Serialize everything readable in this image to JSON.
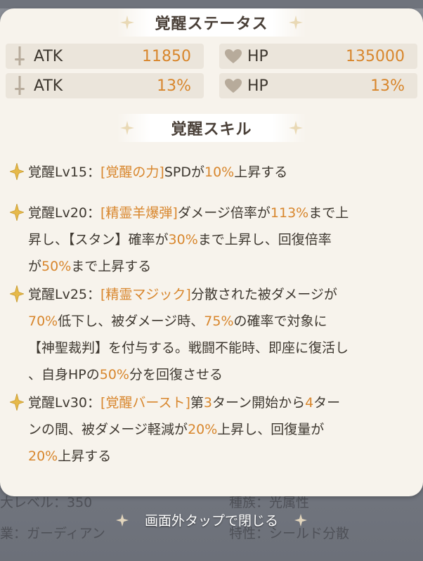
{
  "panel": {
    "status_title": "覚醒ステータス",
    "skill_title": "覚醒スキル"
  },
  "stats": [
    {
      "name": "ATK",
      "value": "11850",
      "icon": "sword-icon"
    },
    {
      "name": "HP",
      "value": "135000",
      "icon": "heart-icon"
    },
    {
      "name": "ATK",
      "value": "13%",
      "icon": "sword-icon"
    },
    {
      "name": "HP",
      "value": "13%",
      "icon": "heart-icon"
    }
  ],
  "skills": [
    {
      "lines": [
        [
          [
            "覚醒Lv15：",
            ""
          ],
          [
            "[覚醒の力]",
            "hl"
          ],
          [
            "SPDが",
            ""
          ],
          [
            "10%",
            "hl"
          ],
          [
            "上昇する",
            ""
          ]
        ]
      ]
    },
    {
      "lines": [
        [
          [
            "覚醒Lv20：",
            ""
          ],
          [
            "[精霊羊爆弾]",
            "hl"
          ],
          [
            "ダメージ倍率が",
            ""
          ],
          [
            "113%",
            "hl"
          ],
          [
            "まで上",
            ""
          ]
        ],
        [
          [
            "昇し、【スタン】確率が",
            ""
          ],
          [
            "30%",
            "hl"
          ],
          [
            "まで上昇し、回復倍率",
            ""
          ]
        ],
        [
          [
            "が",
            ""
          ],
          [
            "50%",
            "hl"
          ],
          [
            "まで上昇する",
            ""
          ]
        ]
      ]
    },
    {
      "lines": [
        [
          [
            "覚醒Lv25：",
            ""
          ],
          [
            "[精霊マジック]",
            "hl"
          ],
          [
            "分散された被ダメージが",
            ""
          ]
        ],
        [
          [
            "70%",
            "hl"
          ],
          [
            "低下し、被ダメージ時、",
            ""
          ],
          [
            "75%",
            "hl"
          ],
          [
            "の確率で対象に",
            ""
          ]
        ],
        [
          [
            "【神聖裁判】を付与する。戦闘不能時、即座に復活し",
            ""
          ]
        ],
        [
          [
            "、自身HPの",
            ""
          ],
          [
            "50%",
            "hl"
          ],
          [
            "分を回復させる",
            ""
          ]
        ]
      ]
    },
    {
      "lines": [
        [
          [
            "覚醒Lv30：",
            ""
          ],
          [
            "[覚醒バースト]",
            "hl"
          ],
          [
            "第",
            ""
          ],
          [
            "3",
            "hl"
          ],
          [
            "ターン開始から",
            ""
          ],
          [
            "4",
            "hl"
          ],
          [
            "ター",
            ""
          ]
        ],
        [
          [
            "ンの間、被ダメージ軽減が",
            ""
          ],
          [
            "20%",
            "hl"
          ],
          [
            "上昇し、回復量が",
            ""
          ]
        ],
        [
          [
            "20%",
            "hl"
          ],
          [
            "上昇する",
            ""
          ]
        ]
      ]
    }
  ],
  "background": {
    "row1_left": "大レベル：350",
    "row1_right": "種族：光属性",
    "row2_left": "業：ガーディアン",
    "row2_right": "特性：シールド分散"
  },
  "close_hint": "画面外タップで閉じる",
  "colors": {
    "accent": "#d8862c",
    "text": "#3e3830",
    "panel": "#f7f3ec"
  }
}
